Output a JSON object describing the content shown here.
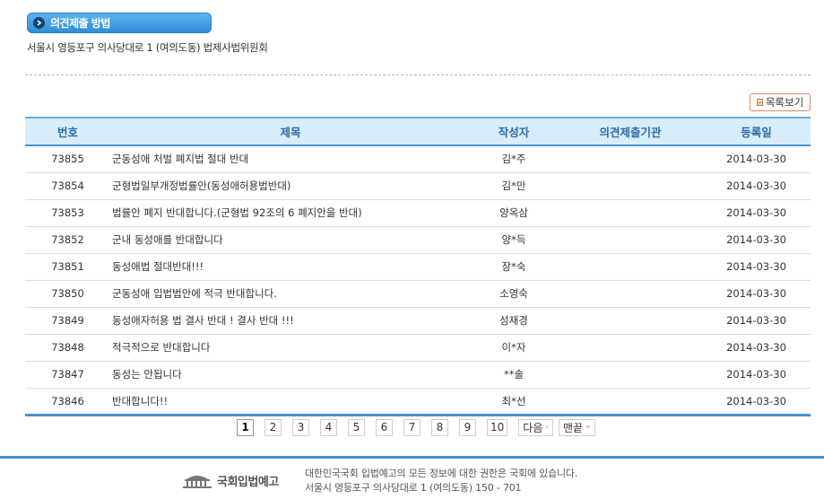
{
  "section": {
    "title": "의견제출 방법",
    "icon": "chevron-right-icon"
  },
  "address": "서울시 영등포구 의사당대로 1 (여의도동) 법제사법위원회",
  "list_button": {
    "label": "목록보기",
    "icon": "list-icon"
  },
  "table": {
    "headers": {
      "number": "번호",
      "title": "제목",
      "author": "작성자",
      "org": "의견제출기관",
      "date": "등록일"
    },
    "rows": [
      {
        "number": "73855",
        "title": "군동성애 처벌 폐지법 절대 반대",
        "author": "김*주",
        "org": "",
        "date": "2014-03-30"
      },
      {
        "number": "73854",
        "title": "군형법일부개정법률안(동성애허용법반대)",
        "author": "김*만",
        "org": "",
        "date": "2014-03-30"
      },
      {
        "number": "73853",
        "title": "법률안 폐지 반대합니다.(군형법 92조의 6 폐지안을 반대)",
        "author": "양옥삼",
        "org": "",
        "date": "2014-03-30"
      },
      {
        "number": "73852",
        "title": "군내 동성애를 반대합니다",
        "author": "양*득",
        "org": "",
        "date": "2014-03-30"
      },
      {
        "number": "73851",
        "title": "동성애법 절대반대!!!",
        "author": "장*숙",
        "org": "",
        "date": "2014-03-30"
      },
      {
        "number": "73850",
        "title": "군동성애 입법법안에 적극 반대합니다.",
        "author": "소영숙",
        "org": "",
        "date": "2014-03-30"
      },
      {
        "number": "73849",
        "title": "동성애자허용 법 결사 반대 ! 결사 반대 !!!",
        "author": "성재경",
        "org": "",
        "date": "2014-03-30"
      },
      {
        "number": "73848",
        "title": "적극적으로 반대합니다",
        "author": "이*자",
        "org": "",
        "date": "2014-03-30"
      },
      {
        "number": "73847",
        "title": "동성는 안됩니다",
        "author": "**솔",
        "org": "",
        "date": "2014-03-30"
      },
      {
        "number": "73846",
        "title": "반대합니다!!",
        "author": "최*선",
        "org": "",
        "date": "2014-03-30"
      }
    ]
  },
  "pagination": {
    "pages": [
      "1",
      "2",
      "3",
      "4",
      "5",
      "6",
      "7",
      "8",
      "9",
      "10"
    ],
    "current": "1",
    "next_label": "다음",
    "last_label": "맨끝"
  },
  "footer": {
    "logo_text": "국회입법예고",
    "rights": "대한민국국회 입법예고의 모든 정보에 대한 권한은 국회에 있습니다.",
    "address": "서울시 영등포구 의사당대로 1 (여의도동) 150 - 701"
  },
  "colors": {
    "accent": "#4a91cf",
    "header_bg": "#d8ecfa",
    "pill": "#2f8ed6"
  }
}
